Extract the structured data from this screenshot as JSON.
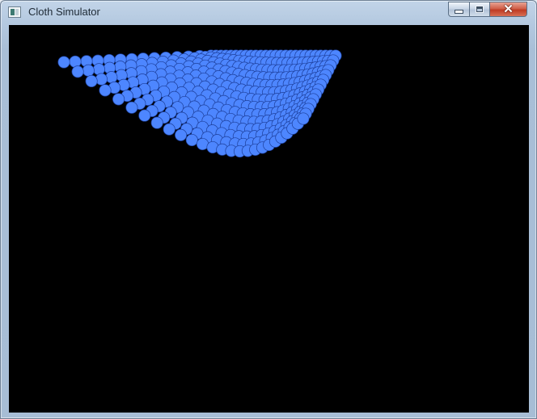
{
  "window": {
    "title": "Cloth Simulator",
    "app_icon": "app-window-icon",
    "controls": {
      "minimize_icon": "minimize-icon",
      "maximize_icon": "maximize-icon",
      "close_icon": "close-icon"
    }
  },
  "canvas": {
    "background": "#000000",
    "cloth": {
      "particle_color": "#4d86ff",
      "particle_outline_color": "#1d3f9a",
      "grid_rows": 14,
      "grid_cols": 26
    }
  }
}
